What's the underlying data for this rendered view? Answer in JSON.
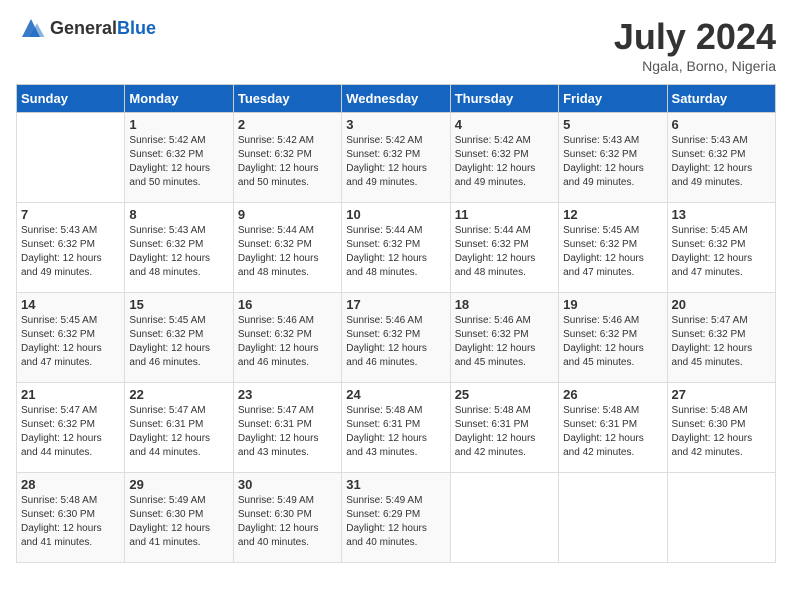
{
  "header": {
    "logo_general": "General",
    "logo_blue": "Blue",
    "month_title": "July 2024",
    "subtitle": "Ngala, Borno, Nigeria"
  },
  "days_of_week": [
    "Sunday",
    "Monday",
    "Tuesday",
    "Wednesday",
    "Thursday",
    "Friday",
    "Saturday"
  ],
  "weeks": [
    [
      {
        "day": "",
        "sunrise": "",
        "sunset": "",
        "daylight": ""
      },
      {
        "day": "1",
        "sunrise": "Sunrise: 5:42 AM",
        "sunset": "Sunset: 6:32 PM",
        "daylight": "Daylight: 12 hours and 50 minutes."
      },
      {
        "day": "2",
        "sunrise": "Sunrise: 5:42 AM",
        "sunset": "Sunset: 6:32 PM",
        "daylight": "Daylight: 12 hours and 50 minutes."
      },
      {
        "day": "3",
        "sunrise": "Sunrise: 5:42 AM",
        "sunset": "Sunset: 6:32 PM",
        "daylight": "Daylight: 12 hours and 49 minutes."
      },
      {
        "day": "4",
        "sunrise": "Sunrise: 5:42 AM",
        "sunset": "Sunset: 6:32 PM",
        "daylight": "Daylight: 12 hours and 49 minutes."
      },
      {
        "day": "5",
        "sunrise": "Sunrise: 5:43 AM",
        "sunset": "Sunset: 6:32 PM",
        "daylight": "Daylight: 12 hours and 49 minutes."
      },
      {
        "day": "6",
        "sunrise": "Sunrise: 5:43 AM",
        "sunset": "Sunset: 6:32 PM",
        "daylight": "Daylight: 12 hours and 49 minutes."
      }
    ],
    [
      {
        "day": "7",
        "sunrise": "Sunrise: 5:43 AM",
        "sunset": "Sunset: 6:32 PM",
        "daylight": "Daylight: 12 hours and 49 minutes."
      },
      {
        "day": "8",
        "sunrise": "Sunrise: 5:43 AM",
        "sunset": "Sunset: 6:32 PM",
        "daylight": "Daylight: 12 hours and 48 minutes."
      },
      {
        "day": "9",
        "sunrise": "Sunrise: 5:44 AM",
        "sunset": "Sunset: 6:32 PM",
        "daylight": "Daylight: 12 hours and 48 minutes."
      },
      {
        "day": "10",
        "sunrise": "Sunrise: 5:44 AM",
        "sunset": "Sunset: 6:32 PM",
        "daylight": "Daylight: 12 hours and 48 minutes."
      },
      {
        "day": "11",
        "sunrise": "Sunrise: 5:44 AM",
        "sunset": "Sunset: 6:32 PM",
        "daylight": "Daylight: 12 hours and 48 minutes."
      },
      {
        "day": "12",
        "sunrise": "Sunrise: 5:45 AM",
        "sunset": "Sunset: 6:32 PM",
        "daylight": "Daylight: 12 hours and 47 minutes."
      },
      {
        "day": "13",
        "sunrise": "Sunrise: 5:45 AM",
        "sunset": "Sunset: 6:32 PM",
        "daylight": "Daylight: 12 hours and 47 minutes."
      }
    ],
    [
      {
        "day": "14",
        "sunrise": "Sunrise: 5:45 AM",
        "sunset": "Sunset: 6:32 PM",
        "daylight": "Daylight: 12 hours and 47 minutes."
      },
      {
        "day": "15",
        "sunrise": "Sunrise: 5:45 AM",
        "sunset": "Sunset: 6:32 PM",
        "daylight": "Daylight: 12 hours and 46 minutes."
      },
      {
        "day": "16",
        "sunrise": "Sunrise: 5:46 AM",
        "sunset": "Sunset: 6:32 PM",
        "daylight": "Daylight: 12 hours and 46 minutes."
      },
      {
        "day": "17",
        "sunrise": "Sunrise: 5:46 AM",
        "sunset": "Sunset: 6:32 PM",
        "daylight": "Daylight: 12 hours and 46 minutes."
      },
      {
        "day": "18",
        "sunrise": "Sunrise: 5:46 AM",
        "sunset": "Sunset: 6:32 PM",
        "daylight": "Daylight: 12 hours and 45 minutes."
      },
      {
        "day": "19",
        "sunrise": "Sunrise: 5:46 AM",
        "sunset": "Sunset: 6:32 PM",
        "daylight": "Daylight: 12 hours and 45 minutes."
      },
      {
        "day": "20",
        "sunrise": "Sunrise: 5:47 AM",
        "sunset": "Sunset: 6:32 PM",
        "daylight": "Daylight: 12 hours and 45 minutes."
      }
    ],
    [
      {
        "day": "21",
        "sunrise": "Sunrise: 5:47 AM",
        "sunset": "Sunset: 6:32 PM",
        "daylight": "Daylight: 12 hours and 44 minutes."
      },
      {
        "day": "22",
        "sunrise": "Sunrise: 5:47 AM",
        "sunset": "Sunset: 6:31 PM",
        "daylight": "Daylight: 12 hours and 44 minutes."
      },
      {
        "day": "23",
        "sunrise": "Sunrise: 5:47 AM",
        "sunset": "Sunset: 6:31 PM",
        "daylight": "Daylight: 12 hours and 43 minutes."
      },
      {
        "day": "24",
        "sunrise": "Sunrise: 5:48 AM",
        "sunset": "Sunset: 6:31 PM",
        "daylight": "Daylight: 12 hours and 43 minutes."
      },
      {
        "day": "25",
        "sunrise": "Sunrise: 5:48 AM",
        "sunset": "Sunset: 6:31 PM",
        "daylight": "Daylight: 12 hours and 42 minutes."
      },
      {
        "day": "26",
        "sunrise": "Sunrise: 5:48 AM",
        "sunset": "Sunset: 6:31 PM",
        "daylight": "Daylight: 12 hours and 42 minutes."
      },
      {
        "day": "27",
        "sunrise": "Sunrise: 5:48 AM",
        "sunset": "Sunset: 6:30 PM",
        "daylight": "Daylight: 12 hours and 42 minutes."
      }
    ],
    [
      {
        "day": "28",
        "sunrise": "Sunrise: 5:48 AM",
        "sunset": "Sunset: 6:30 PM",
        "daylight": "Daylight: 12 hours and 41 minutes."
      },
      {
        "day": "29",
        "sunrise": "Sunrise: 5:49 AM",
        "sunset": "Sunset: 6:30 PM",
        "daylight": "Daylight: 12 hours and 41 minutes."
      },
      {
        "day": "30",
        "sunrise": "Sunrise: 5:49 AM",
        "sunset": "Sunset: 6:30 PM",
        "daylight": "Daylight: 12 hours and 40 minutes."
      },
      {
        "day": "31",
        "sunrise": "Sunrise: 5:49 AM",
        "sunset": "Sunset: 6:29 PM",
        "daylight": "Daylight: 12 hours and 40 minutes."
      },
      {
        "day": "",
        "sunrise": "",
        "sunset": "",
        "daylight": ""
      },
      {
        "day": "",
        "sunrise": "",
        "sunset": "",
        "daylight": ""
      },
      {
        "day": "",
        "sunrise": "",
        "sunset": "",
        "daylight": ""
      }
    ]
  ]
}
